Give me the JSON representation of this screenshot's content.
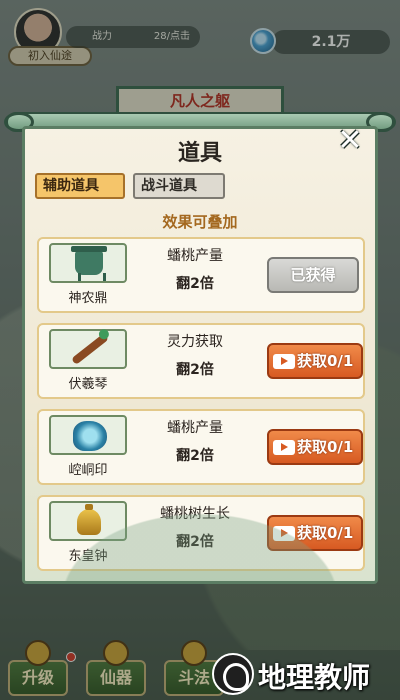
{
  "hud": {
    "rank_label": "初入仙途",
    "power_label": "战力",
    "power_value": "28/点击",
    "currency_value": "2.1万"
  },
  "background_banner": "凡人之躯",
  "modal": {
    "title": "道具",
    "close_symbol": "✕",
    "tabs": [
      {
        "label": "辅助道具",
        "active": true
      },
      {
        "label": "战斗道具",
        "active": false
      }
    ],
    "subtitle": "效果可叠加",
    "items": [
      {
        "name": "神农鼎",
        "icon": "bronze-ding-icon",
        "effect": "蟠桃产量",
        "multiplier": "翻2倍",
        "button": "已获得",
        "owned": true
      },
      {
        "name": "伏羲琴",
        "icon": "guqin-icon",
        "effect": "灵力获取",
        "multiplier": "翻2倍",
        "button": "获取0/1",
        "owned": false
      },
      {
        "name": "崆峒印",
        "icon": "jade-seal-icon",
        "effect": "蟠桃产量",
        "multiplier": "翻2倍",
        "button": "获取0/1",
        "owned": false
      },
      {
        "name": "东皇钟",
        "icon": "golden-bell-icon",
        "effect": "蟠桃树生长",
        "multiplier": "翻2倍",
        "button": "获取0/1",
        "owned": false
      }
    ]
  },
  "bottom_nav": [
    {
      "label": "升级"
    },
    {
      "label": "仙器"
    },
    {
      "label": "斗法"
    }
  ],
  "watermark": {
    "text": "地理教师"
  },
  "colors": {
    "accent_orange": "#d75a22",
    "tab_active": "#f5c56a",
    "frame_green": "#5b7d63",
    "subtitle_brown": "#a4681f"
  }
}
